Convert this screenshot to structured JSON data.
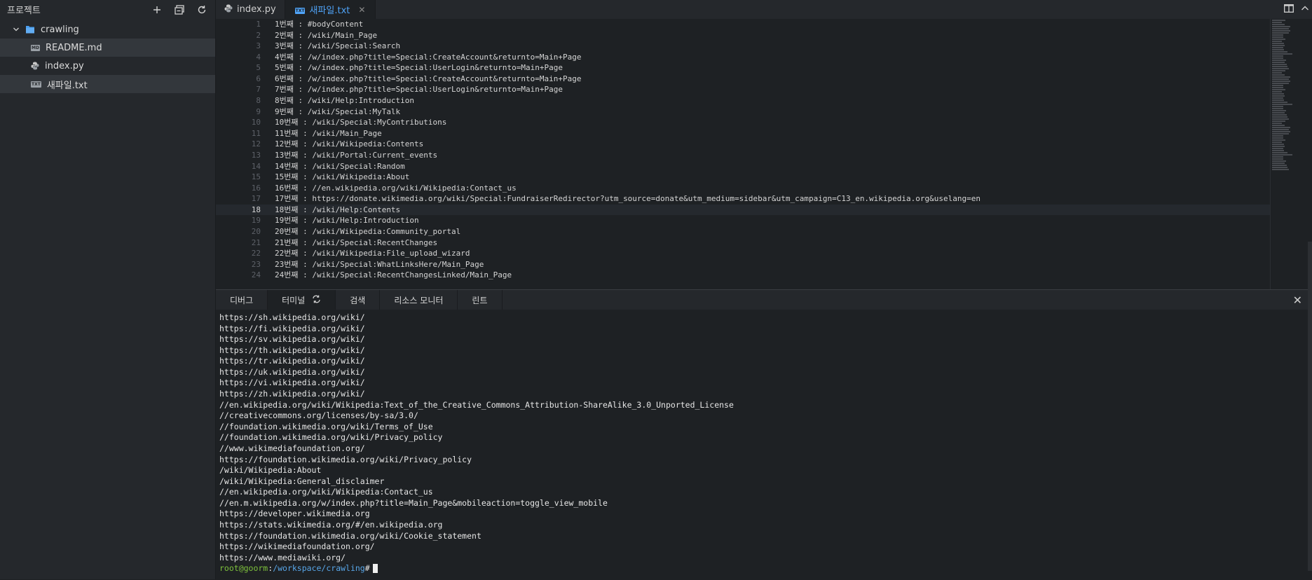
{
  "sidebar": {
    "title": "프로젝트",
    "folder": "crawling",
    "files": [
      {
        "name": "README.md",
        "tag": "MD",
        "selected": true
      },
      {
        "name": "index.py",
        "tag": "py",
        "selected": false
      },
      {
        "name": "새파일.txt",
        "tag": "TXT",
        "selected": true
      }
    ]
  },
  "tabs": [
    {
      "label": "index.py",
      "active": false
    },
    {
      "label": "새파일.txt",
      "active": true
    }
  ],
  "editor": {
    "current_line": 18,
    "lines": [
      "1번째 : #bodyContent",
      "2번째 : /wiki/Main_Page",
      "3번째 : /wiki/Special:Search",
      "4번째 : /w/index.php?title=Special:CreateAccount&returnto=Main+Page",
      "5번째 : /w/index.php?title=Special:UserLogin&returnto=Main+Page",
      "6번째 : /w/index.php?title=Special:CreateAccount&returnto=Main+Page",
      "7번째 : /w/index.php?title=Special:UserLogin&returnto=Main+Page",
      "8번째 : /wiki/Help:Introduction",
      "9번째 : /wiki/Special:MyTalk",
      "10번째 : /wiki/Special:MyContributions",
      "11번째 : /wiki/Main_Page",
      "12번째 : /wiki/Wikipedia:Contents",
      "13번째 : /wiki/Portal:Current_events",
      "14번째 : /wiki/Special:Random",
      "15번째 : /wiki/Wikipedia:About",
      "16번째 : //en.wikipedia.org/wiki/Wikipedia:Contact_us",
      "17번째 : https://donate.wikimedia.org/wiki/Special:FundraiserRedirector?utm_source=donate&utm_medium=sidebar&utm_campaign=C13_en.wikipedia.org&uselang=en",
      "18번째 : /wiki/Help:Contents",
      "19번째 : /wiki/Help:Introduction",
      "20번째 : /wiki/Wikipedia:Community_portal",
      "21번째 : /wiki/Special:RecentChanges",
      "22번째 : /wiki/Wikipedia:File_upload_wizard",
      "23번째 : /wiki/Special:WhatLinksHere/Main_Page",
      "24번째 : /wiki/Special:RecentChangesLinked/Main_Page"
    ]
  },
  "panel": {
    "tabs": [
      "디버그",
      "터미널",
      "검색",
      "리소스 모니터",
      "린트"
    ],
    "active_tab": "터미널",
    "terminal_lines": [
      "https://sh.wikipedia.org/wiki/",
      "https://fi.wikipedia.org/wiki/",
      "https://sv.wikipedia.org/wiki/",
      "https://th.wikipedia.org/wiki/",
      "https://tr.wikipedia.org/wiki/",
      "https://uk.wikipedia.org/wiki/",
      "https://vi.wikipedia.org/wiki/",
      "https://zh.wikipedia.org/wiki/",
      "//en.wikipedia.org/wiki/Wikipedia:Text_of_the_Creative_Commons_Attribution-ShareAlike_3.0_Unported_License",
      "//creativecommons.org/licenses/by-sa/3.0/",
      "//foundation.wikimedia.org/wiki/Terms_of_Use",
      "//foundation.wikimedia.org/wiki/Privacy_policy",
      "//www.wikimediafoundation.org/",
      "https://foundation.wikimedia.org/wiki/Privacy_policy",
      "/wiki/Wikipedia:About",
      "/wiki/Wikipedia:General_disclaimer",
      "//en.wikipedia.org/wiki/Wikipedia:Contact_us",
      "//en.m.wikipedia.org/w/index.php?title=Main_Page&mobileaction=toggle_view_mobile",
      "https://developer.wikimedia.org",
      "https://stats.wikimedia.org/#/en.wikipedia.org",
      "https://foundation.wikimedia.org/wiki/Cookie_statement",
      "https://wikimediafoundation.org/",
      "https://www.mediawiki.org/"
    ],
    "prompt": {
      "user": "root@goorm",
      "sep": ":",
      "path": "/workspace/crawling",
      "suffix": "#"
    }
  },
  "icons": {
    "sidebar_actions": [
      "plus-icon",
      "collapse-all-icon",
      "refresh-icon"
    ],
    "editor_actions": [
      "split-editor-icon",
      "chevron-up-icon"
    ]
  },
  "colors": {
    "accent": "#4fa3f7",
    "prompt_user": "#7ec23c",
    "prompt_path": "#58a6e8"
  }
}
